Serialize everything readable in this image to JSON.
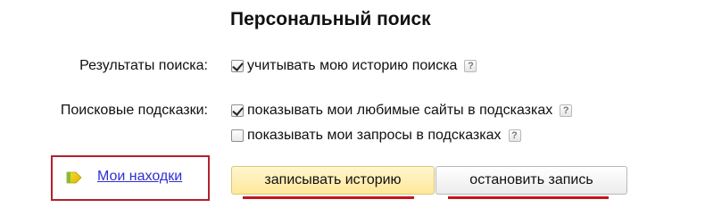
{
  "title": "Персональный поиск",
  "search_results": {
    "label": "Результаты поиска:",
    "options": [
      {
        "text": "учитывать мою историю поиска",
        "checked": true,
        "help": "?"
      }
    ]
  },
  "suggestions": {
    "label": "Поисковые подсказки:",
    "options": [
      {
        "text": "показывать мои любимые сайты в подсказках",
        "checked": true,
        "help": "?"
      },
      {
        "text": "показывать мои запросы в подсказках",
        "checked": false,
        "help": "?"
      }
    ]
  },
  "favorites_link": "Мои находки",
  "buttons": {
    "record": "записывать историю",
    "stop": "остановить запись"
  },
  "colors": {
    "highlight_box": "#b3212b",
    "underline": "#c3161f",
    "link": "#2f2fd1"
  },
  "icons": {
    "help": "question-mark-icon",
    "favorites": "bookmark-flag-icon"
  }
}
